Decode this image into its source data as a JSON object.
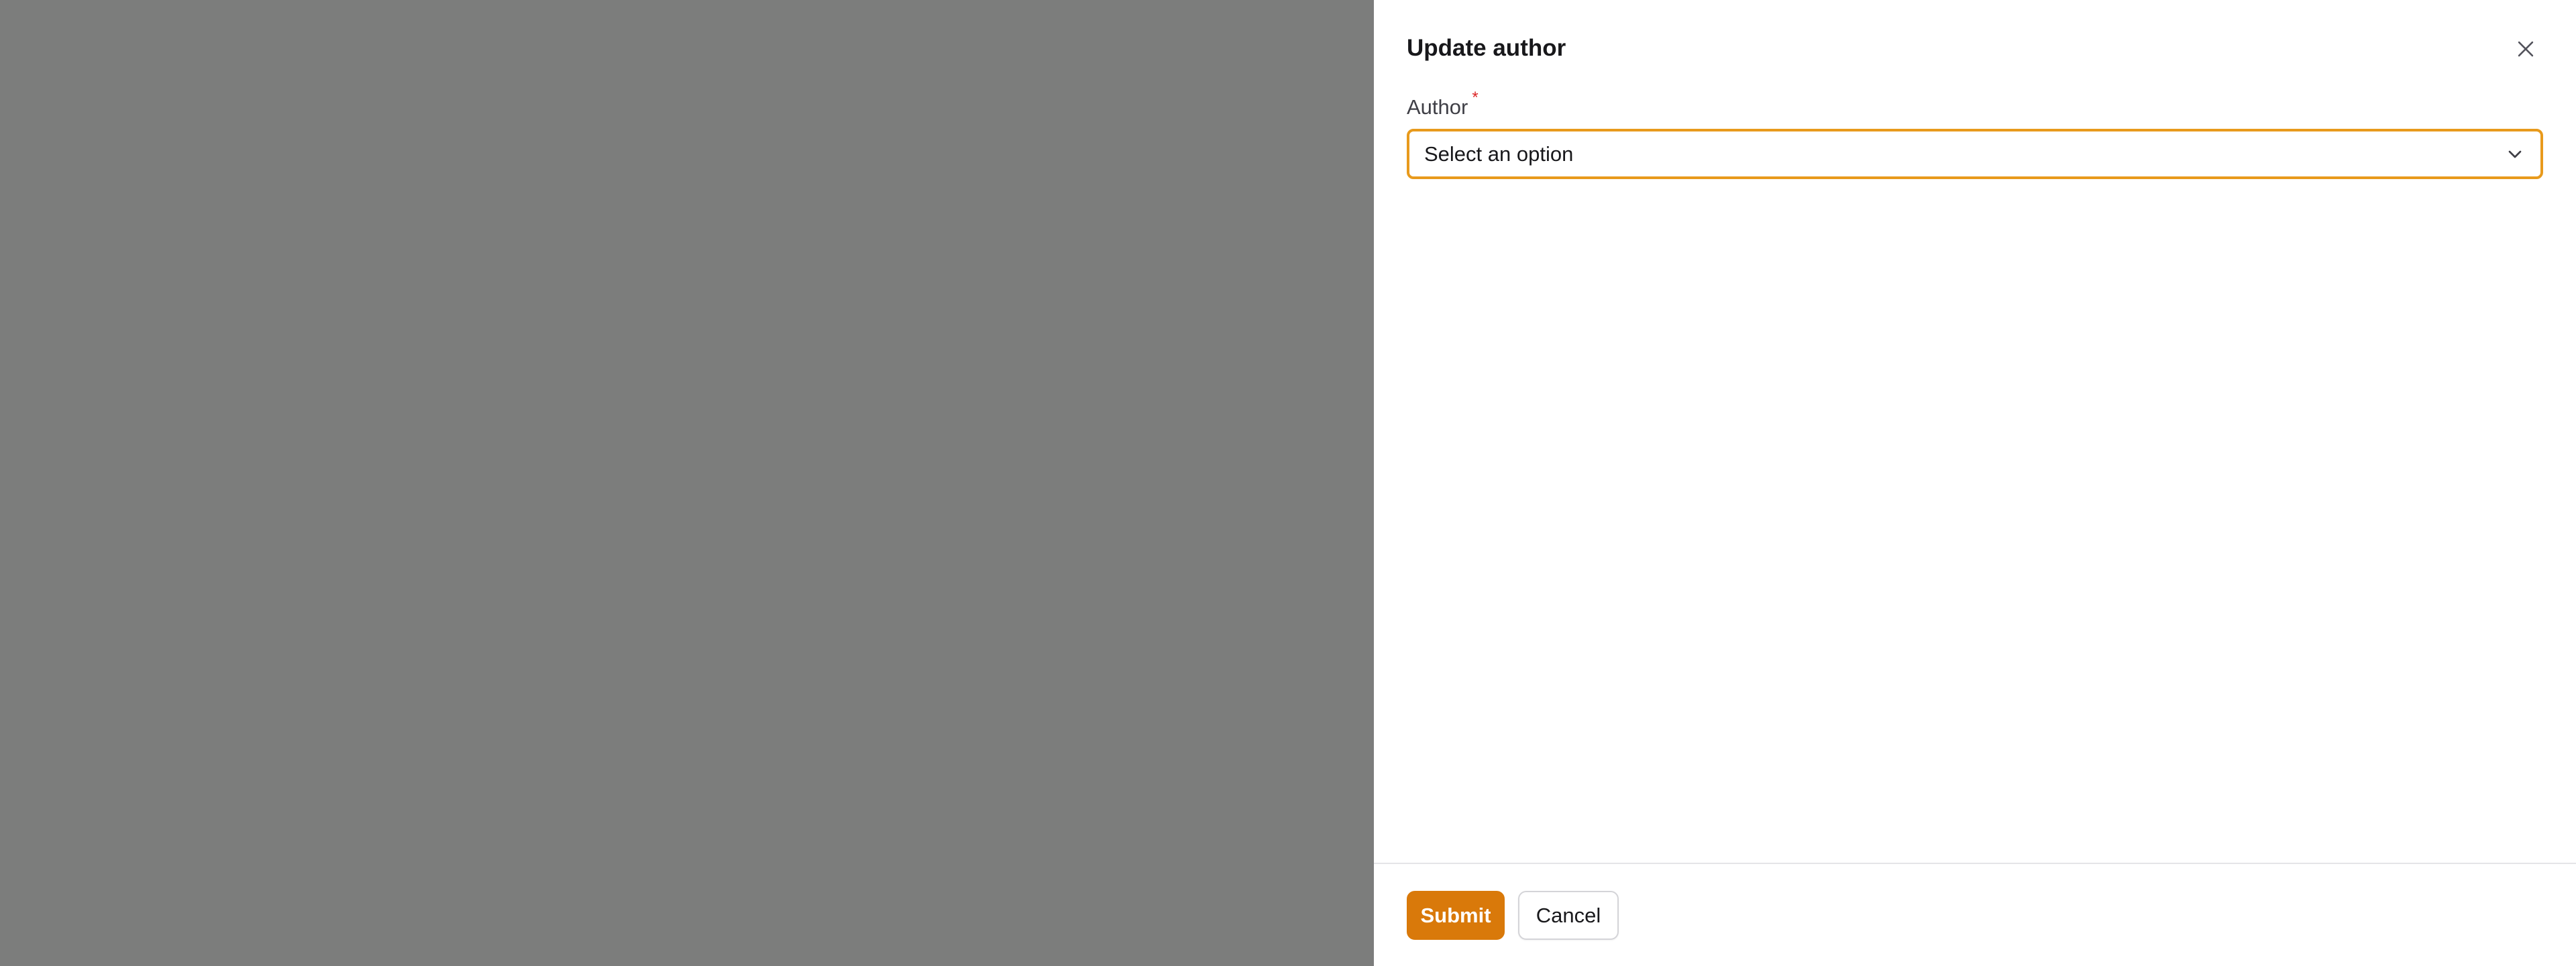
{
  "modal": {
    "title": "Update author"
  },
  "form": {
    "author": {
      "label": "Author",
      "required_marker": "*",
      "placeholder": "Select an option"
    }
  },
  "footer": {
    "submit_label": "Submit",
    "cancel_label": "Cancel"
  },
  "colors": {
    "accent": "#d9790a",
    "focus_border": "#e89a1c",
    "backdrop": "#7c7d7c",
    "required": "#dc2626"
  }
}
